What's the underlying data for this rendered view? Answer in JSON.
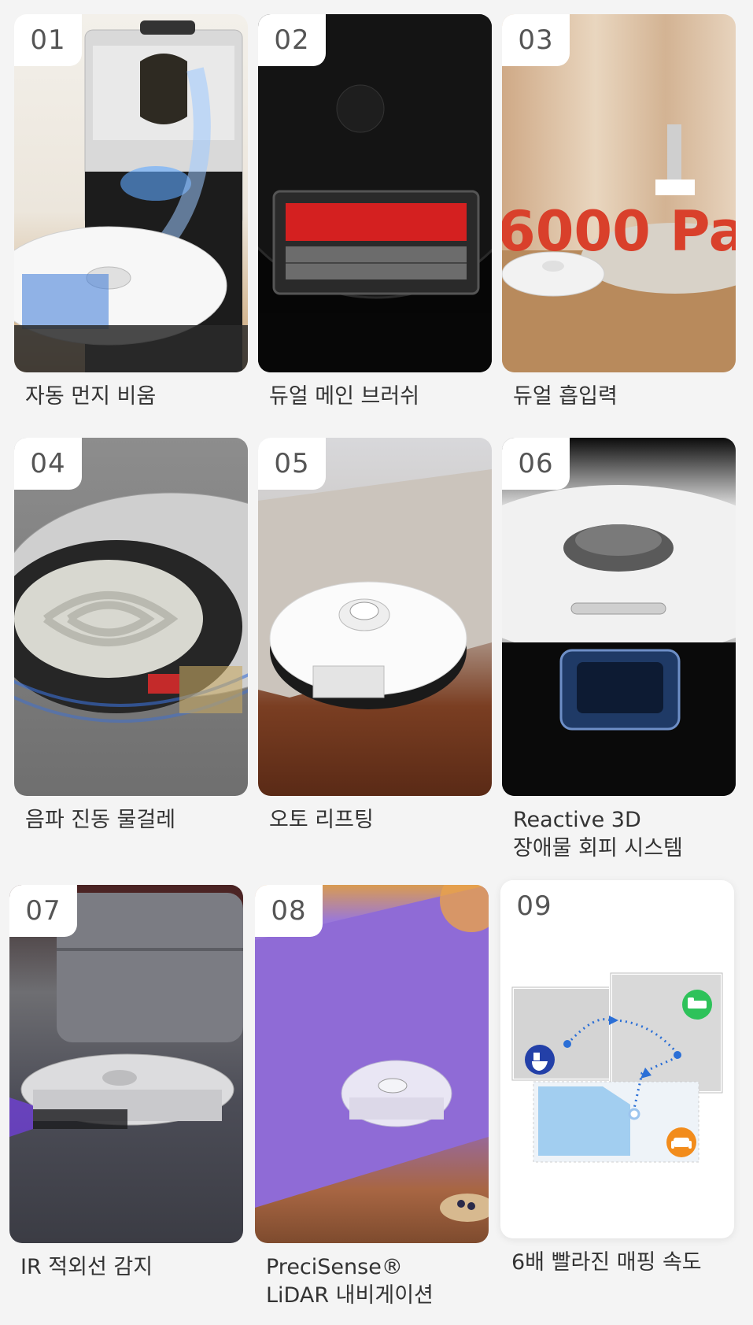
{
  "features": [
    {
      "num": "01",
      "caption": "자동 먼지 비움"
    },
    {
      "num": "02",
      "caption": "듀얼 메인 브러쉬"
    },
    {
      "num": "03",
      "caption": "듀얼 흡입력",
      "overlay": "6000 Pa"
    },
    {
      "num": "04",
      "caption": "음파 진동 물걸레"
    },
    {
      "num": "05",
      "caption": "오토 리프팅"
    },
    {
      "num": "06",
      "caption_line1": "Reactive 3D",
      "caption_line2": "장애물 회피 시스템"
    },
    {
      "num": "07",
      "caption": "IR 적외선 감지"
    },
    {
      "num": "08",
      "caption_line1": "PreciSense®",
      "caption_line2": "LiDAR 내비게이션"
    },
    {
      "num": "09",
      "caption": "6배 빨라진 매핑 속도"
    }
  ],
  "colors": {
    "accent_red": "#d9402b",
    "map_blue": "#2b6fd6",
    "icon_blue": "#2340a8",
    "icon_green": "#2ec25a",
    "icon_orange": "#f28c1c"
  },
  "icons": [
    "toilet-icon",
    "bed-icon",
    "sofa-icon"
  ]
}
